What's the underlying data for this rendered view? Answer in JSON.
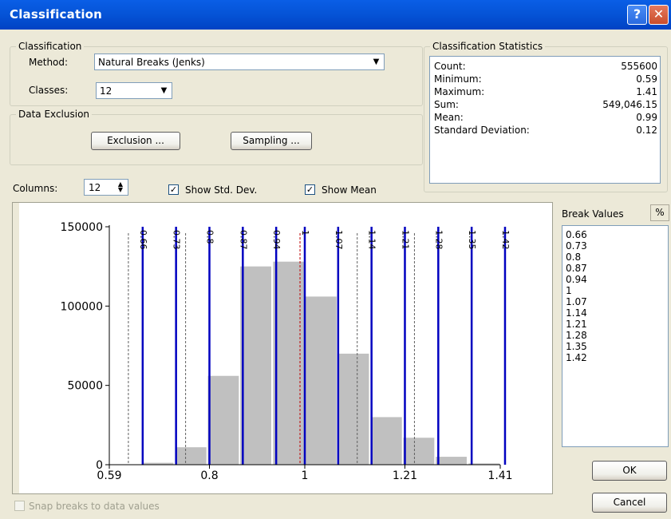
{
  "window": {
    "title": "Classification",
    "help_glyph": "?",
    "close_glyph": "✕"
  },
  "classification": {
    "group_label": "Classification",
    "method_label": "Method:",
    "method_value": "Natural Breaks (Jenks)",
    "classes_label": "Classes:",
    "classes_value": "12"
  },
  "exclusion": {
    "group_label": "Data Exclusion",
    "exclusion_button": "Exclusion ...",
    "sampling_button": "Sampling ..."
  },
  "statistics": {
    "group_label": "Classification Statistics",
    "rows": [
      {
        "label": "Count:",
        "value": "555600"
      },
      {
        "label": "Minimum:",
        "value": "0.59"
      },
      {
        "label": "Maximum:",
        "value": "1.41"
      },
      {
        "label": "Sum:",
        "value": "549,046.15"
      },
      {
        "label": "Mean:",
        "value": "0.99"
      },
      {
        "label": "Standard Deviation:",
        "value": "0.12"
      }
    ]
  },
  "options": {
    "columns_label": "Columns:",
    "columns_value": "12",
    "show_std_dev_label": "Show Std. Dev.",
    "show_std_dev_checked": true,
    "show_mean_label": "Show Mean",
    "show_mean_checked": true,
    "snap_label": "Snap breaks to data values",
    "snap_checked": false
  },
  "break_values": {
    "header": "Break Values",
    "percent_button": "%",
    "values": [
      "0.66",
      "0.73",
      "0.8",
      "0.87",
      "0.94",
      "1",
      "1.07",
      "1.14",
      "1.21",
      "1.28",
      "1.35",
      "1.42"
    ]
  },
  "buttons": {
    "ok": "OK",
    "cancel": "Cancel"
  },
  "chart_data": {
    "type": "bar",
    "xlim": [
      0.59,
      1.41
    ],
    "ylim": [
      0,
      150000
    ],
    "x_tick_labels": [
      "0.59",
      "0.8",
      "1",
      "1.21",
      "1.41"
    ],
    "x_ticks": [
      0.59,
      0.8,
      1.0,
      1.21,
      1.41
    ],
    "y_tick_labels": [
      "0",
      "50000",
      "100000",
      "150000"
    ],
    "y_ticks": [
      0,
      50000,
      100000,
      150000
    ],
    "bin_width": 0.06833,
    "bins": [
      {
        "start": 0.59,
        "count": 0
      },
      {
        "start": 0.658,
        "count": 1200
      },
      {
        "start": 0.727,
        "count": 11000
      },
      {
        "start": 0.795,
        "count": 56000
      },
      {
        "start": 0.863,
        "count": 125000
      },
      {
        "start": 0.932,
        "count": 128000
      },
      {
        "start": 1.0,
        "count": 106000
      },
      {
        "start": 1.068,
        "count": 70000
      },
      {
        "start": 1.137,
        "count": 30000
      },
      {
        "start": 1.205,
        "count": 17000
      },
      {
        "start": 1.273,
        "count": 5000
      },
      {
        "start": 1.342,
        "count": 800
      }
    ],
    "breaks": [
      0.66,
      0.73,
      0.8,
      0.87,
      0.94,
      1,
      1.07,
      1.14,
      1.21,
      1.28,
      1.35,
      1.42
    ],
    "break_labels": [
      "0.66",
      "0.73",
      "0.8",
      "0.87",
      "0.94",
      "1",
      "1.07",
      "1.14",
      "1.21",
      "1.28",
      "1.35",
      "1.42"
    ],
    "mean": 0.99,
    "std_dev_lines": [
      0.63,
      0.75,
      0.87,
      1.11,
      1.23,
      1.35
    ],
    "colors": {
      "bar": "#c0c0c0",
      "break_line": "#0000c0",
      "std_line": "#606060",
      "mean_line": "#c00000"
    }
  }
}
